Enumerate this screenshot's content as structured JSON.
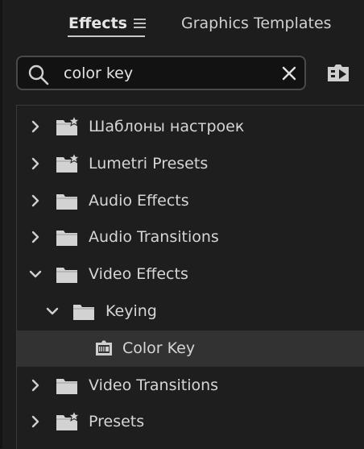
{
  "tabs": {
    "effects": "Effects",
    "graphics_templates": "Graphics Templates"
  },
  "search": {
    "value": "color key"
  },
  "tree": [
    {
      "label": "Шаблоны настроек",
      "expanded": false,
      "icon": "preset-folder-icon",
      "depth": 0
    },
    {
      "label": "Lumetri Presets",
      "expanded": false,
      "icon": "preset-folder-icon",
      "depth": 0
    },
    {
      "label": "Audio Effects",
      "expanded": false,
      "icon": "folder-icon",
      "depth": 0
    },
    {
      "label": "Audio Transitions",
      "expanded": false,
      "icon": "folder-icon",
      "depth": 0
    },
    {
      "label": "Video Effects",
      "expanded": true,
      "icon": "folder-icon",
      "depth": 0
    },
    {
      "label": "Keying",
      "expanded": true,
      "icon": "folder-icon",
      "depth": 1
    },
    {
      "label": "Color Key",
      "icon": "effect-icon",
      "depth": 2,
      "selected": true
    },
    {
      "label": "Video Transitions",
      "expanded": false,
      "icon": "folder-icon",
      "depth": 0
    },
    {
      "label": "Presets",
      "expanded": false,
      "icon": "preset-folder-icon",
      "depth": 0
    }
  ]
}
